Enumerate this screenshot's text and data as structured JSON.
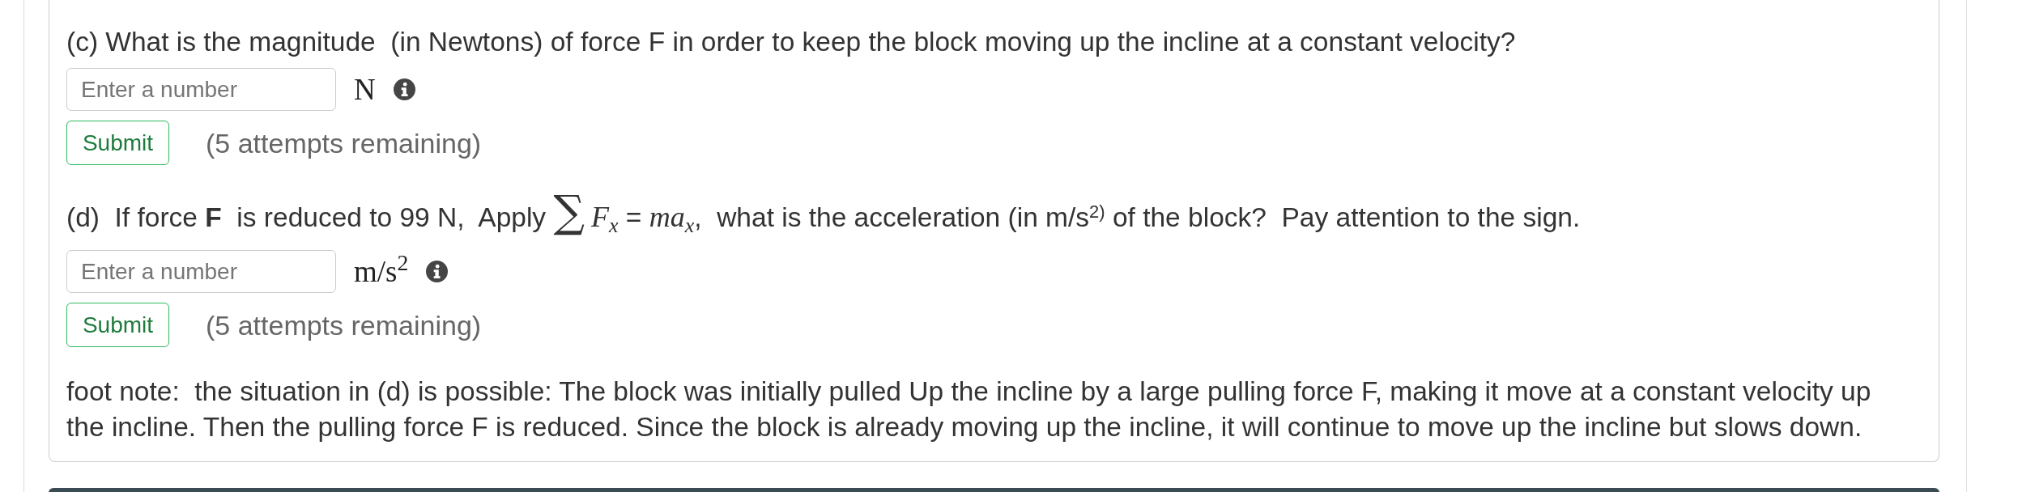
{
  "parts": [
    {
      "question": [
        {
          "kind": "text",
          "text": "(c) What is the magnitude  (in Newtons) of force F in order to keep the block moving up the incline at a constant velocity?"
        }
      ],
      "answer": {
        "placeholder": "Enter a number",
        "unit": "N"
      },
      "submit": "Submit",
      "attempts": "(5 attempts remaining)"
    },
    {
      "question": [
        {
          "kind": "text",
          "text": "(d)  If force "
        },
        {
          "kind": "bold",
          "text": "F"
        },
        {
          "kind": "text",
          "text": "  is reduced to 99 N,  Apply "
        },
        {
          "kind": "sigma",
          "text": "∑"
        },
        {
          "kind": "var",
          "text": "F"
        },
        {
          "kind": "sub",
          "text": "x"
        },
        {
          "kind": "text",
          "text": " = "
        },
        {
          "kind": "var",
          "text": "ma"
        },
        {
          "kind": "sub",
          "text": "x"
        },
        {
          "kind": "text",
          "text": ",  what is the acceleration (in m/s"
        },
        {
          "kind": "sup",
          "text": "2)"
        },
        {
          "kind": "text",
          "text": " of the block?  Pay attention to the sign."
        }
      ],
      "answer": {
        "placeholder": "Enter a number",
        "unit": "m/s$^{2}$"
      },
      "submit": "Submit",
      "attempts": "(5 attempts remaining)"
    }
  ],
  "footnote": "foot note:  the situation in (d) is possible: The block was initially pulled Up the incline by a large pulling force F, making it move at a constant velocity up the incline. Then the pulling force F is reduced. Since the block is already moving up the incline, it will continue to move up the incline but slows down."
}
